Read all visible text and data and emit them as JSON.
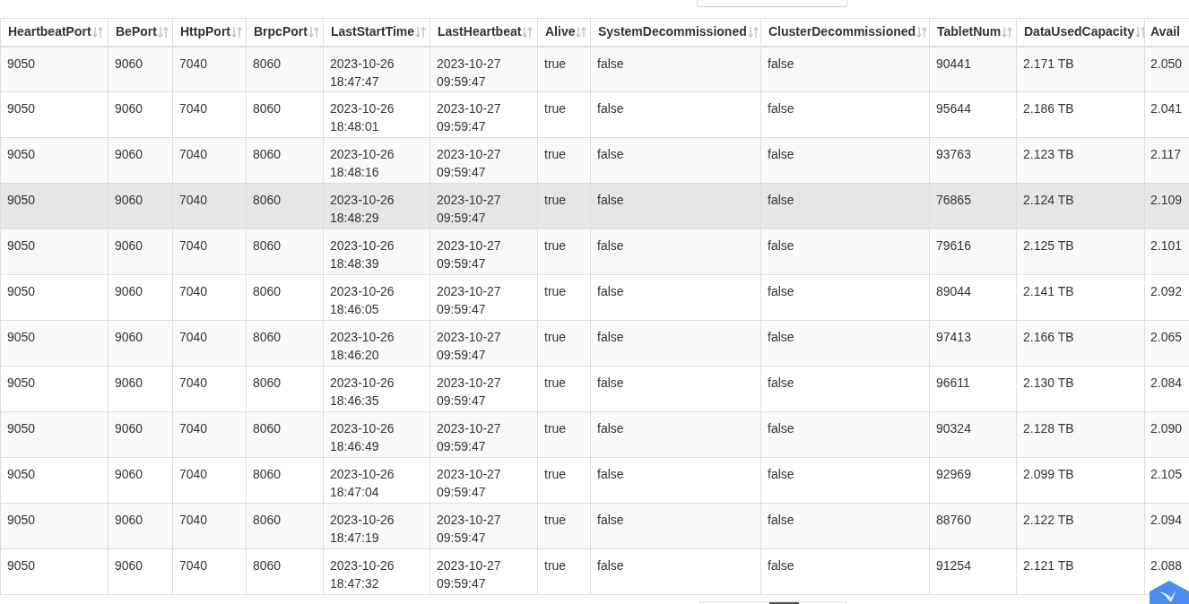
{
  "table": {
    "columns": [
      "HeartbeatPort",
      "BePort",
      "HttpPort",
      "BrpcPort",
      "LastStartTime",
      "LastHeartbeat",
      "Alive",
      "SystemDecommissioned",
      "ClusterDecommissioned",
      "TabletNum",
      "DataUsedCapacity",
      "Avail"
    ],
    "rows": [
      {
        "hovered": false,
        "cells": [
          "9050",
          "9060",
          "7040",
          "8060",
          "2023-10-26 18:47:47",
          "2023-10-27 09:59:47",
          "true",
          "false",
          "false",
          "90441",
          "2.171 TB",
          "2.050"
        ]
      },
      {
        "hovered": false,
        "cells": [
          "9050",
          "9060",
          "7040",
          "8060",
          "2023-10-26 18:48:01",
          "2023-10-27 09:59:47",
          "true",
          "false",
          "false",
          "95644",
          "2.186 TB",
          "2.041"
        ]
      },
      {
        "hovered": false,
        "cells": [
          "9050",
          "9060",
          "7040",
          "8060",
          "2023-10-26 18:48:16",
          "2023-10-27 09:59:47",
          "true",
          "false",
          "false",
          "93763",
          "2.123 TB",
          "2.117"
        ]
      },
      {
        "hovered": true,
        "cells": [
          "9050",
          "9060",
          "7040",
          "8060",
          "2023-10-26 18:48:29",
          "2023-10-27 09:59:47",
          "true",
          "false",
          "false",
          "76865",
          "2.124 TB",
          "2.109"
        ]
      },
      {
        "hovered": false,
        "cells": [
          "9050",
          "9060",
          "7040",
          "8060",
          "2023-10-26 18:48:39",
          "2023-10-27 09:59:47",
          "true",
          "false",
          "false",
          "79616",
          "2.125 TB",
          "2.101"
        ]
      },
      {
        "hovered": false,
        "cells": [
          "9050",
          "9060",
          "7040",
          "8060",
          "2023-10-26 18:46:05",
          "2023-10-27 09:59:47",
          "true",
          "false",
          "false",
          "89044",
          "2.141 TB",
          "2.092"
        ]
      },
      {
        "hovered": false,
        "cells": [
          "9050",
          "9060",
          "7040",
          "8060",
          "2023-10-26 18:46:20",
          "2023-10-27 09:59:47",
          "true",
          "false",
          "false",
          "97413",
          "2.166 TB",
          "2.065"
        ]
      },
      {
        "hovered": false,
        "cells": [
          "9050",
          "9060",
          "7040",
          "8060",
          "2023-10-26 18:46:35",
          "2023-10-27 09:59:47",
          "true",
          "false",
          "false",
          "96611",
          "2.130 TB",
          "2.084"
        ]
      },
      {
        "hovered": false,
        "cells": [
          "9050",
          "9060",
          "7040",
          "8060",
          "2023-10-26 18:46:49",
          "2023-10-27 09:59:47",
          "true",
          "false",
          "false",
          "90324",
          "2.128 TB",
          "2.090"
        ]
      },
      {
        "hovered": false,
        "cells": [
          "9050",
          "9060",
          "7040",
          "8060",
          "2023-10-26 18:47:04",
          "2023-10-27 09:59:47",
          "true",
          "false",
          "false",
          "92969",
          "2.099 TB",
          "2.105"
        ]
      },
      {
        "hovered": false,
        "cells": [
          "9050",
          "9060",
          "7040",
          "8060",
          "2023-10-26 18:47:19",
          "2023-10-27 09:59:47",
          "true",
          "false",
          "false",
          "88760",
          "2.122 TB",
          "2.094"
        ]
      },
      {
        "hovered": false,
        "cells": [
          "9050",
          "9060",
          "7040",
          "8060",
          "2023-10-26 18:47:32",
          "2023-10-27 09:59:47",
          "true",
          "false",
          "false",
          "91254",
          "2.121 TB",
          "2.088"
        ]
      }
    ]
  }
}
